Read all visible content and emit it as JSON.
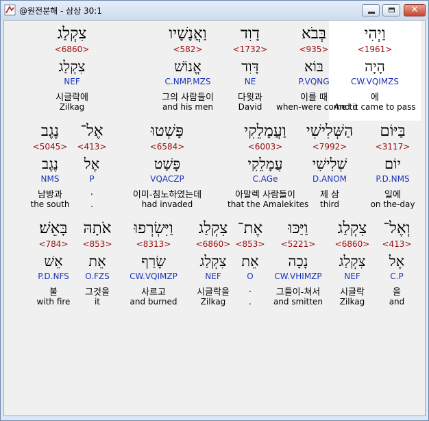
{
  "window": {
    "title": "@원전분해 - 삼상 30:1"
  },
  "rows": [
    [
      {
        "surface": "וַיְהִי",
        "strong": "<1961>",
        "lemma": "הָיָה",
        "parse": "CW.VQIMZS",
        "korean": "에",
        "english": "And it came to pass",
        "highlight": true
      },
      {
        "surface": "בְּבֹא",
        "strong": "<935>",
        "lemma": "בּוֹא",
        "parse": "P.VQNG",
        "korean": "이를 때",
        "english": "when-were come to"
      },
      {
        "surface": "דָוִד",
        "strong": "<1732>",
        "lemma": "דָּוִד",
        "parse": "NE",
        "korean": "다윗과",
        "english": "David"
      },
      {
        "surface": "וַאֲנָשָׁיו",
        "strong": "<582>",
        "lemma": "אֱנוֹשׁ",
        "parse": "C.NMP.MZS",
        "korean": "그의 사람들이",
        "english": "and his men"
      },
      {
        "surface": "צִקְלַג",
        "strong": "<6860>",
        "lemma": "צִקְלַג",
        "parse": "NEF",
        "korean": "시글락에",
        "english": "Zilkag"
      }
    ],
    [
      {
        "surface": "בַּיּוֹם",
        "strong": "<3117>",
        "lemma": "יוֹם",
        "parse": "P.D.NMS",
        "korean": "일에",
        "english": "on the-day"
      },
      {
        "surface": "הַשְּׁלִישִׁי",
        "strong": "<7992>",
        "lemma": "שְׁלִישִׁי",
        "parse": "D.ANOM",
        "korean": "제 삼",
        "english": "third"
      },
      {
        "surface": "וַעֲמָלֵקִי",
        "strong": "<6003>",
        "lemma": "עֲמָלֵקִי",
        "parse": "C.AGe",
        "korean": "아말렉 사람들이",
        "english": "that the Amalekites"
      },
      {
        "surface": "פָּשְׁטוּ",
        "strong": "<6584>",
        "lemma": "פָּשַׁט",
        "parse": "VQACZP",
        "korean": "이미-침노하였는데",
        "english": "had invaded"
      },
      {
        "surface": "אֶל־",
        "strong": "<413>",
        "lemma": "אֶל",
        "parse": "P",
        "korean": ".",
        "english": "."
      },
      {
        "surface": "נֶגֶב",
        "strong": "<5045>",
        "lemma": "נֶגֶב",
        "parse": "NMS",
        "korean": "남방과",
        "english": "the south"
      }
    ],
    [
      {
        "surface": "וְאֶל־",
        "strong": "<413>",
        "lemma": "אֶל",
        "parse": "C.P",
        "korean": "을",
        "english": "and"
      },
      {
        "surface": "צִקְלַג",
        "strong": "<6860>",
        "lemma": "צִקְלַג",
        "parse": "NEF",
        "korean": "시글락",
        "english": "Zilkag"
      },
      {
        "surface": "וַיַּכּוּ",
        "strong": "<5221>",
        "lemma": "נָכָה",
        "parse": "CW.VHIMZP",
        "korean": "그들이-쳐서",
        "english": "and smitten"
      },
      {
        "surface": "אֶת־",
        "strong": "<853>",
        "lemma": "אֵת",
        "parse": "O",
        "korean": ".",
        "english": "."
      },
      {
        "surface": "צִקְלַג",
        "strong": "<6860>",
        "lemma": "צִקְלַג",
        "parse": "NEF",
        "korean": "시글락을",
        "english": "Zilkag"
      },
      {
        "surface": "וַיִּשְׂרְפוּ",
        "strong": "<8313>",
        "lemma": "שָׂרַף",
        "parse": "CW.VQIMZP",
        "korean": "사르고",
        "english": "and burned"
      },
      {
        "surface": "אֹתָהּ",
        "strong": "<853>",
        "lemma": "אֵת",
        "parse": "O.FZS",
        "korean": "그것을",
        "english": "it"
      },
      {
        "surface": "בָּאֵשׁ׃",
        "strong": "<784>",
        "lemma": "אֵשׁ",
        "parse": "P.D.NFS",
        "korean": "불",
        "english": "with fire"
      }
    ]
  ]
}
